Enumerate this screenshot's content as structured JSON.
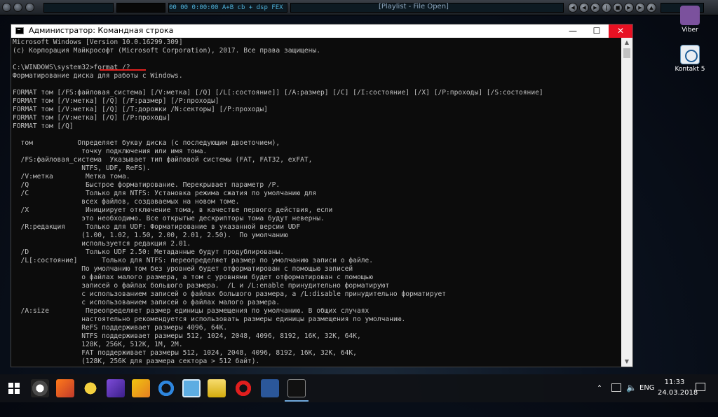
{
  "player": {
    "lcd_left": "00   00   0:00:00   A+B  cb  + dsp  FEX",
    "title": "[Playlist - File Open]"
  },
  "desktop_icons": [
    {
      "label": "Viber"
    },
    {
      "label": "Kontakt 5"
    }
  ],
  "window": {
    "title": "Администратор: Командная строка",
    "minimize": "—",
    "maximize": "☐",
    "close": "✕"
  },
  "console_lines": [
    "Microsoft Windows [Version 10.0.16299.309]",
    "(c) Корпорация Майкрософт (Microsoft Corporation), 2017. Все права защищены.",
    "",
    "C:\\WINDOWS\\system32>format /?",
    "Форматирование диска для работы с Windows.",
    "",
    "FORMAT том [/FS:файловая_система] [/V:метка] [/Q] [/L[:состояние]] [/A:размер] [/C] [/I:состояние] [/X] [/P:проходы] [/S:состояние]",
    "FORMAT том [/V:метка] [/Q] [/F:размер] [/P:проходы]",
    "FORMAT том [/V:метка] [/Q] [/T:дорожки /N:секторы] [/P:проходы]",
    "FORMAT том [/V:метка] [/Q] [/P:проходы]",
    "FORMAT том [/Q]",
    "",
    "  том           Определяет букву диска (с последующим двоеточием),",
    "                 точку подключения или имя тома.",
    "  /FS:файловая_система  Указывает тип файловой системы (FAT, FAT32, exFAT,",
    "                 NTFS, UDF, ReFS).",
    "  /V:метка        Метка тома.",
    "  /Q              Быстрое форматирование. Перекрывает параметр /P.",
    "  /C              Только для NTFS: Установка режима сжатия по умолчанию для",
    "                 всех файлов, создаваемых на новом томе.",
    "  /X              Инициирует отключение тома, в качестве первого действия, если",
    "                 это необходимо. Все открытые дескрипторы тома будут неверны.",
    "  /R:редакция     Только для UDF: Форматирование в указанной версии UDF",
    "                 (1.00, 1.02, 1.50, 2.00, 2.01, 2.50).  По умолчанию",
    "                 используется редакция 2.01.",
    "  /D              Только UDF 2.50: Метаданные будут продублированы.",
    "  /L[:состояние]      Только для NTFS: переопределяет размер по умолчанию записи о файле.",
    "                 По умолчанию том без уровней будет отформатирован с помощью записей",
    "                 о файлах малого размера, а том с уровнями будет отформатирован с помощью",
    "                 записей о файлах большого размера.  /L и /L:enable принудительно форматируют",
    "                 с использованием записей о файлах большого размера, а /L:disable принудительно форматирует",
    "                 с использованием записей о файлах малого размера.",
    "  /A:size         Переопределяет размер единицы размещения по умолчанию. В общих случаях",
    "                 настоятельно рекомендуется использовать размеры единицы размещения по умолчанию.",
    "                 ReFS поддерживает размеры 4096, 64K.",
    "                 NTFS поддерживает размеры 512, 1024, 2048, 4096, 8192, 16K, 32K, 64K,",
    "                 128K, 256K, 512K, 1M, 2M.",
    "                 FAT поддерживает размеры 512, 1024, 2048, 4096, 8192, 16K, 32K, 64K,",
    "                 (128K, 256K для размера сектора > 512 байт)."
  ],
  "taskbar": {
    "apps": [
      "start",
      "eye-app",
      "fox-app",
      "chat-app",
      "aimp-app",
      "winamp-app",
      "refresh-app",
      "viewer-app",
      "explorer-app",
      "opera-app",
      "word-app",
      "cmd-app"
    ],
    "language": "ENG",
    "time": "11:33",
    "date": "24.03.2018"
  },
  "colors": {
    "console_bg": "#0c0c0c",
    "console_text": "#c0c0c0",
    "close_button": "#e81123",
    "underline": "#e0201e"
  }
}
